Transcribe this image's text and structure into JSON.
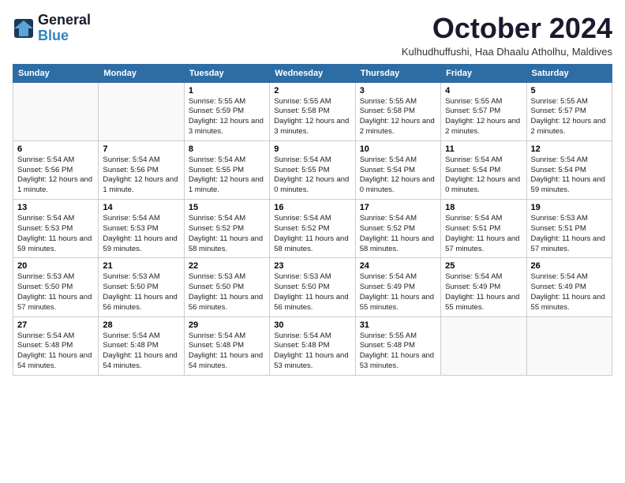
{
  "header": {
    "logo_line1": "General",
    "logo_line2": "Blue",
    "month_title": "October 2024",
    "subtitle": "Kulhudhuffushi, Haa Dhaalu Atholhu, Maldives"
  },
  "weekdays": [
    "Sunday",
    "Monday",
    "Tuesday",
    "Wednesday",
    "Thursday",
    "Friday",
    "Saturday"
  ],
  "weeks": [
    [
      {
        "day": "",
        "info": ""
      },
      {
        "day": "",
        "info": ""
      },
      {
        "day": "1",
        "info": "Sunrise: 5:55 AM\nSunset: 5:59 PM\nDaylight: 12 hours\nand 3 minutes."
      },
      {
        "day": "2",
        "info": "Sunrise: 5:55 AM\nSunset: 5:58 PM\nDaylight: 12 hours\nand 3 minutes."
      },
      {
        "day": "3",
        "info": "Sunrise: 5:55 AM\nSunset: 5:58 PM\nDaylight: 12 hours\nand 2 minutes."
      },
      {
        "day": "4",
        "info": "Sunrise: 5:55 AM\nSunset: 5:57 PM\nDaylight: 12 hours\nand 2 minutes."
      },
      {
        "day": "5",
        "info": "Sunrise: 5:55 AM\nSunset: 5:57 PM\nDaylight: 12 hours\nand 2 minutes."
      }
    ],
    [
      {
        "day": "6",
        "info": "Sunrise: 5:54 AM\nSunset: 5:56 PM\nDaylight: 12 hours\nand 1 minute."
      },
      {
        "day": "7",
        "info": "Sunrise: 5:54 AM\nSunset: 5:56 PM\nDaylight: 12 hours\nand 1 minute."
      },
      {
        "day": "8",
        "info": "Sunrise: 5:54 AM\nSunset: 5:55 PM\nDaylight: 12 hours\nand 1 minute."
      },
      {
        "day": "9",
        "info": "Sunrise: 5:54 AM\nSunset: 5:55 PM\nDaylight: 12 hours\nand 0 minutes."
      },
      {
        "day": "10",
        "info": "Sunrise: 5:54 AM\nSunset: 5:54 PM\nDaylight: 12 hours\nand 0 minutes."
      },
      {
        "day": "11",
        "info": "Sunrise: 5:54 AM\nSunset: 5:54 PM\nDaylight: 12 hours\nand 0 minutes."
      },
      {
        "day": "12",
        "info": "Sunrise: 5:54 AM\nSunset: 5:54 PM\nDaylight: 11 hours\nand 59 minutes."
      }
    ],
    [
      {
        "day": "13",
        "info": "Sunrise: 5:54 AM\nSunset: 5:53 PM\nDaylight: 11 hours\nand 59 minutes."
      },
      {
        "day": "14",
        "info": "Sunrise: 5:54 AM\nSunset: 5:53 PM\nDaylight: 11 hours\nand 59 minutes."
      },
      {
        "day": "15",
        "info": "Sunrise: 5:54 AM\nSunset: 5:52 PM\nDaylight: 11 hours\nand 58 minutes."
      },
      {
        "day": "16",
        "info": "Sunrise: 5:54 AM\nSunset: 5:52 PM\nDaylight: 11 hours\nand 58 minutes."
      },
      {
        "day": "17",
        "info": "Sunrise: 5:54 AM\nSunset: 5:52 PM\nDaylight: 11 hours\nand 58 minutes."
      },
      {
        "day": "18",
        "info": "Sunrise: 5:54 AM\nSunset: 5:51 PM\nDaylight: 11 hours\nand 57 minutes."
      },
      {
        "day": "19",
        "info": "Sunrise: 5:53 AM\nSunset: 5:51 PM\nDaylight: 11 hours\nand 57 minutes."
      }
    ],
    [
      {
        "day": "20",
        "info": "Sunrise: 5:53 AM\nSunset: 5:50 PM\nDaylight: 11 hours\nand 57 minutes."
      },
      {
        "day": "21",
        "info": "Sunrise: 5:53 AM\nSunset: 5:50 PM\nDaylight: 11 hours\nand 56 minutes."
      },
      {
        "day": "22",
        "info": "Sunrise: 5:53 AM\nSunset: 5:50 PM\nDaylight: 11 hours\nand 56 minutes."
      },
      {
        "day": "23",
        "info": "Sunrise: 5:53 AM\nSunset: 5:50 PM\nDaylight: 11 hours\nand 56 minutes."
      },
      {
        "day": "24",
        "info": "Sunrise: 5:54 AM\nSunset: 5:49 PM\nDaylight: 11 hours\nand 55 minutes."
      },
      {
        "day": "25",
        "info": "Sunrise: 5:54 AM\nSunset: 5:49 PM\nDaylight: 11 hours\nand 55 minutes."
      },
      {
        "day": "26",
        "info": "Sunrise: 5:54 AM\nSunset: 5:49 PM\nDaylight: 11 hours\nand 55 minutes."
      }
    ],
    [
      {
        "day": "27",
        "info": "Sunrise: 5:54 AM\nSunset: 5:48 PM\nDaylight: 11 hours\nand 54 minutes."
      },
      {
        "day": "28",
        "info": "Sunrise: 5:54 AM\nSunset: 5:48 PM\nDaylight: 11 hours\nand 54 minutes."
      },
      {
        "day": "29",
        "info": "Sunrise: 5:54 AM\nSunset: 5:48 PM\nDaylight: 11 hours\nand 54 minutes."
      },
      {
        "day": "30",
        "info": "Sunrise: 5:54 AM\nSunset: 5:48 PM\nDaylight: 11 hours\nand 53 minutes."
      },
      {
        "day": "31",
        "info": "Sunrise: 5:55 AM\nSunset: 5:48 PM\nDaylight: 11 hours\nand 53 minutes."
      },
      {
        "day": "",
        "info": ""
      },
      {
        "day": "",
        "info": ""
      }
    ]
  ]
}
